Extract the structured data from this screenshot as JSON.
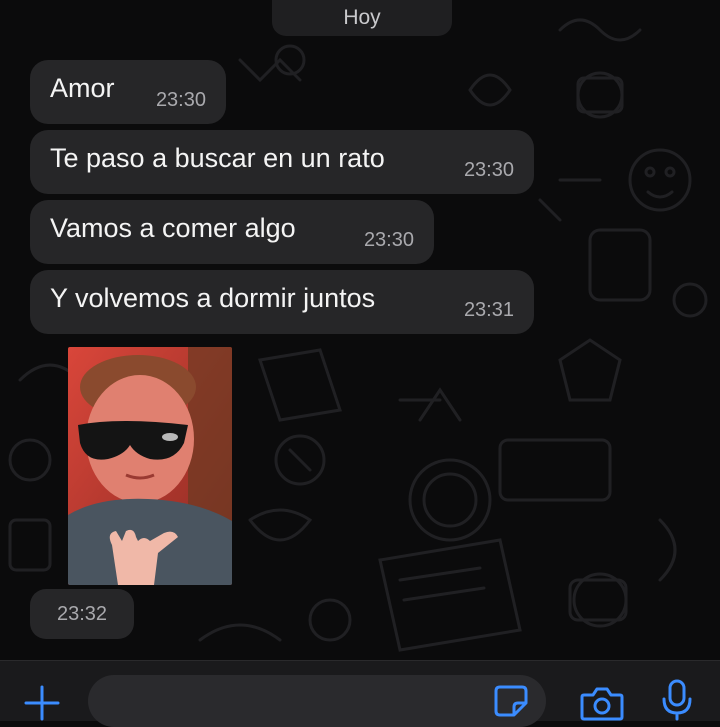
{
  "chat": {
    "date_label": "Hoy",
    "messages": [
      {
        "text": "Amor",
        "time": "23:30"
      },
      {
        "text": "Te paso a buscar en un rato",
        "time": "23:30"
      },
      {
        "text": "Vamos a comer algo",
        "time": "23:30"
      },
      {
        "text": "Y volvemos a dormir juntos",
        "time": "23:31"
      }
    ],
    "photo_message": {
      "time": "23:32"
    }
  },
  "input_bar": {
    "placeholder": "",
    "icons": [
      "plus-icon",
      "sticker-icon",
      "camera-icon",
      "microphone-icon"
    ]
  },
  "colors": {
    "background": "#0b0b0c",
    "bubble": "#262628",
    "accent": "#3b8cff"
  }
}
